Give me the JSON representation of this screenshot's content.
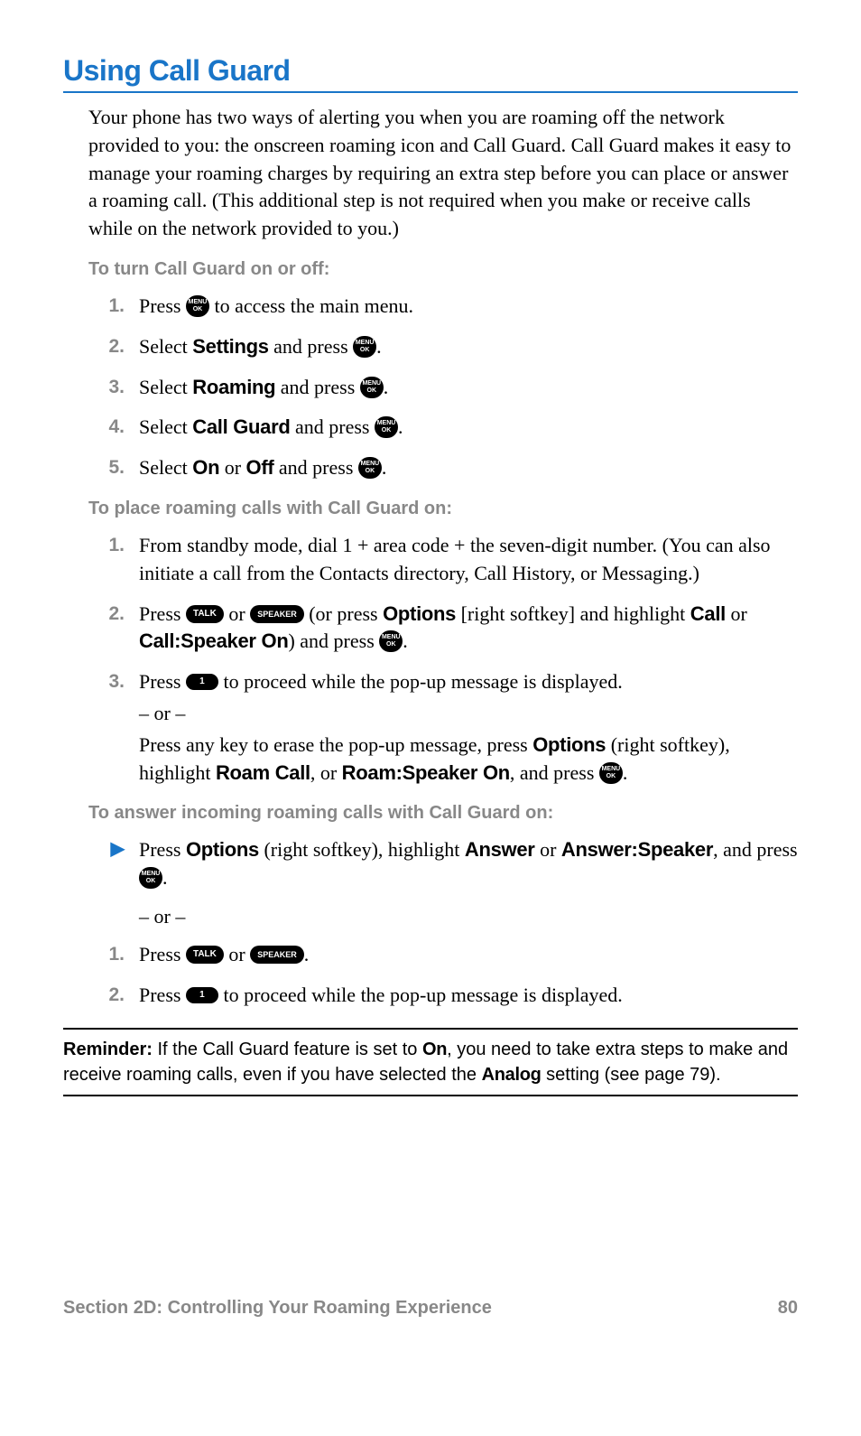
{
  "title": "Using Call Guard",
  "intro": "Your phone has two ways of alerting you when you are roaming off the network provided to you: the onscreen roaming icon and Call Guard. Call Guard makes it easy to manage your roaming charges by requiring an extra step before you can place or answer a roaming call. (This additional step is not required when you make or receive calls while on the network provided to you.)",
  "sub1": "To turn Call Guard on or off:",
  "s1": {
    "n1": "1.",
    "t1a": "Press ",
    "t1b": " to access the main menu.",
    "n2": "2.",
    "t2a": "Select ",
    "t2b": "Settings",
    "t2c": " and press ",
    "t2d": ".",
    "n3": "3.",
    "t3a": "Select ",
    "t3b": "Roaming",
    "t3c": " and press ",
    "t3d": ".",
    "n4": "4.",
    "t4a": "Select ",
    "t4b": "Call Guard",
    "t4c": " and press ",
    "t4d": ".",
    "n5": "5.",
    "t5a": "Select ",
    "t5b": "On",
    "t5c": " or ",
    "t5d": "Off",
    "t5e": " and press ",
    "t5f": "."
  },
  "sub2": "To place roaming calls with Call Guard on:",
  "s2": {
    "n1": "1.",
    "t1": "From standby mode, dial 1 + area code + the seven-digit number. (You can also initiate a call from the Contacts directory, Call History, or Messaging.)",
    "n2": "2.",
    "t2a": "Press ",
    "t2b": " or ",
    "t2c": " (or press ",
    "t2d": "Options",
    "t2e": " [right softkey] and highlight ",
    "t2f": "Call",
    "t2g": " or ",
    "t2h": "Call:Speaker On",
    "t2i": ") and press ",
    "t2j": ".",
    "n3": "3.",
    "t3a": "Press ",
    "t3b": " to proceed while the pop-up message is displayed.",
    "t3c": "– or –",
    "t3d": "Press any key to erase the pop-up message, press ",
    "t3e": "Options",
    "t3f": " (right softkey), highlight ",
    "t3g": "Roam Call",
    "t3h": ", or ",
    "t3i": "Roam:Speaker On",
    "t3j": ", and press ",
    "t3k": "."
  },
  "sub3": "To answer incoming roaming calls with Call Guard on:",
  "s3": {
    "b1a": "Press ",
    "b1b": "Options",
    "b1c": " (right softkey), highlight ",
    "b1d": "Answer",
    "b1e": " or ",
    "b1f": "Answer:Speaker",
    "b1g": ", and press ",
    "b1h": ".",
    "or": "– or –",
    "n1": "1.",
    "t1a": "Press ",
    "t1b": " or ",
    "t1c": ".",
    "n2": "2.",
    "t2a": "Press ",
    "t2b": " to proceed while the pop-up message is displayed."
  },
  "reminder": {
    "label": "Reminder:",
    "t1": " If the Call Guard feature is set to ",
    "t2": "On",
    "t3": ", you need to take extra steps to make and receive roaming calls, even if you have selected the ",
    "t4": "Analog",
    "t5": " setting (see page 79)."
  },
  "buttons": {
    "menu_top": "MENU",
    "menu_bot": "OK",
    "talk": "TALK",
    "speaker": "SPEAKER",
    "one": "1"
  },
  "footer": {
    "section": "Section 2D: Controlling Your Roaming Experience",
    "page": "80"
  }
}
